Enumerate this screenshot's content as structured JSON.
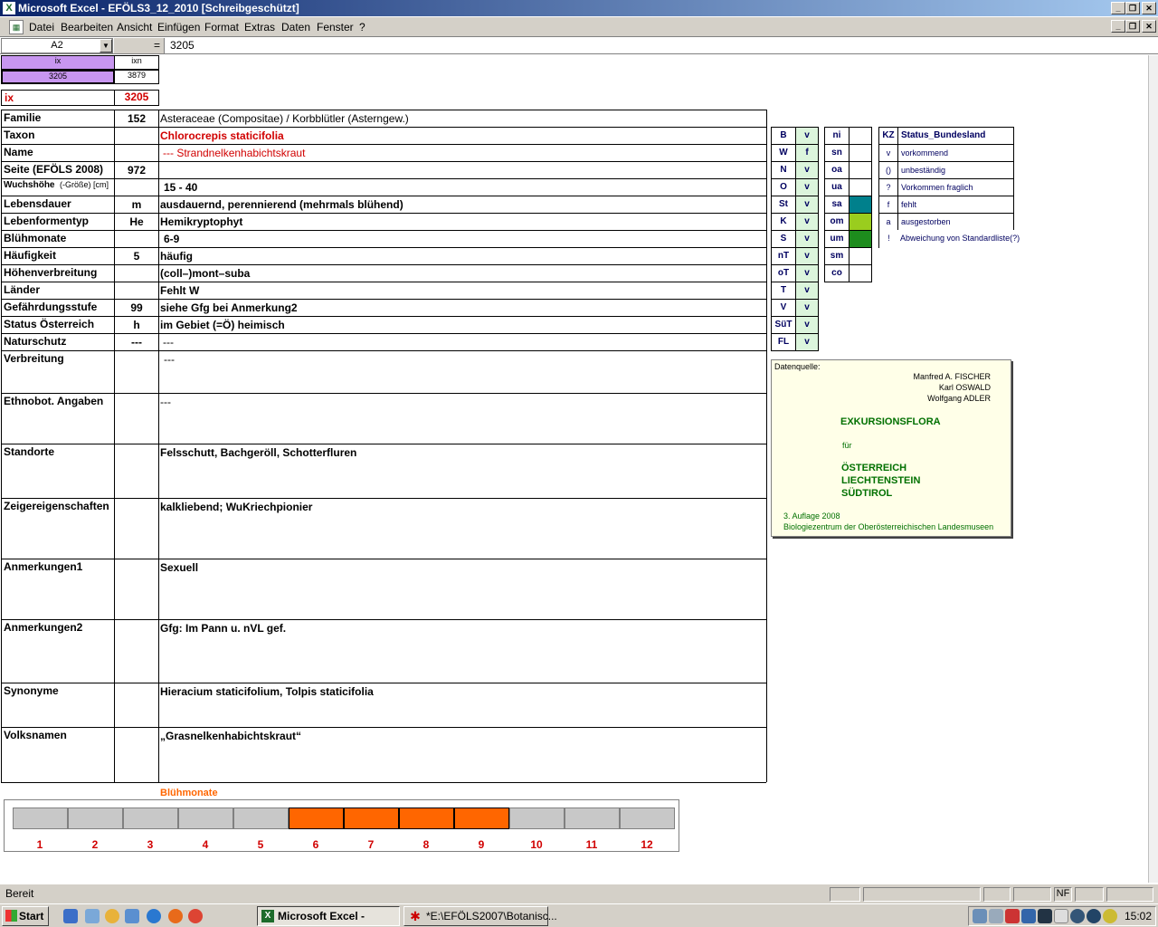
{
  "window": {
    "title": "Microsoft Excel - EFÖLS3_12_2010  [Schreibgeschützt]",
    "app_icon": "excel-icon"
  },
  "menu": [
    "Datei",
    "Bearbeiten",
    "Ansicht",
    "Einfügen",
    "Format",
    "Extras",
    "Daten",
    "Fenster",
    "?"
  ],
  "formula": {
    "name_box": "A2",
    "equals": "=",
    "value": "3205"
  },
  "top_cells": {
    "ix_header": "ix",
    "ixn_header": "ixn",
    "ix_value": "3205",
    "ixn_value": "3879",
    "ix_label": "ix",
    "ix_display": "3205"
  },
  "rows": [
    {
      "label": "Familie",
      "code": "152",
      "value": "Asteraceae (Compositae)  /  Korbblütler (Asterngew.)"
    },
    {
      "label": "Taxon",
      "code": "",
      "value": "Chlorocrepis staticifolia"
    },
    {
      "label": "Name",
      "code": "",
      "value": "--- Strandnelkenhabichtskraut"
    },
    {
      "label": "Seite (EFÖLS 2008)",
      "code": "972",
      "value": ""
    },
    {
      "label": "Wuchshöhe",
      "label_suffix": "(-Größe) [cm]",
      "code": "",
      "value": "15 - 40"
    },
    {
      "label": "Lebensdauer",
      "code": "m",
      "value": "ausdauernd, perennierend (mehrmals blühend)"
    },
    {
      "label": "Lebenformentyp",
      "code": "He",
      "value": "Hemikryptophyt"
    },
    {
      "label": "Blühmonate",
      "code": "",
      "value": "6-9"
    },
    {
      "label": "Häufigkeit",
      "code": "5",
      "value": "häufig"
    },
    {
      "label": "Höhenverbreitung",
      "code": "",
      "value": "(coll–)mont–suba"
    },
    {
      "label": "Länder",
      "code": "",
      "value": "Fehlt W"
    },
    {
      "label": "Gefährdungsstufe",
      "code": "99",
      "value": "siehe Gfg bei Anmerkung2"
    },
    {
      "label": "Status Österreich",
      "code": "h",
      "value": "im Gebiet (=Ö) heimisch"
    },
    {
      "label": "Naturschutz",
      "code": "---",
      "value": "---"
    }
  ],
  "big_rows": [
    {
      "label": "Verbreitung",
      "value": "---"
    },
    {
      "label": "Ethnobot. Angaben",
      "value": "---"
    },
    {
      "label": "Standorte",
      "value": "Felsschutt, Bachgeröll, Schotterfluren"
    },
    {
      "label": "Zeigereigenschaften",
      "value": "kalkliebend; WuKriechpionier"
    },
    {
      "label": "Anmerkungen1",
      "value": "Sexuell"
    },
    {
      "label": "Anmerkungen2",
      "value": "Gfg: Im Pann u. nVL gef."
    },
    {
      "label": "Synonyme",
      "value": "Hieracium staticifolium, Tolpis staticifolia"
    },
    {
      "label": "Volksnamen",
      "value": "„Grasnelkenhabichtskraut“"
    }
  ],
  "regions": [
    {
      "code": "B",
      "status": "v"
    },
    {
      "code": "W",
      "status": "f"
    },
    {
      "code": "N",
      "status": "v"
    },
    {
      "code": "O",
      "status": "v"
    },
    {
      "code": "St",
      "status": "v"
    },
    {
      "code": "K",
      "status": "v"
    },
    {
      "code": "S",
      "status": "v"
    },
    {
      "code": "nT",
      "status": "v"
    },
    {
      "code": "oT",
      "status": "v"
    },
    {
      "code": "T",
      "status": "v"
    },
    {
      "code": "V",
      "status": "v"
    },
    {
      "code": "SüT",
      "status": "v"
    },
    {
      "code": "FL",
      "status": "v"
    }
  ],
  "zones": [
    {
      "code": "ni",
      "color": ""
    },
    {
      "code": "sn",
      "color": ""
    },
    {
      "code": "oa",
      "color": ""
    },
    {
      "code": "ua",
      "color": ""
    },
    {
      "code": "sa",
      "color": "#00808c"
    },
    {
      "code": "om",
      "color": "#9acd1e"
    },
    {
      "code": "um",
      "color": "#1d8c1d"
    },
    {
      "code": "sm",
      "color": ""
    },
    {
      "code": "co",
      "color": ""
    }
  ],
  "status_legend": {
    "header_kz": "KZ",
    "header_title": "Status_Bundesland",
    "items": [
      {
        "kz": "v",
        "text": "vorkommend"
      },
      {
        "kz": "()",
        "text": "unbeständig"
      },
      {
        "kz": "?",
        "text": "Vorkommen fraglich"
      },
      {
        "kz": "f",
        "text": "fehlt"
      },
      {
        "kz": "a",
        "text": "ausgestorben"
      },
      {
        "kz": "!",
        "text": "Abweichung von Standardliste(?)"
      }
    ]
  },
  "source": {
    "label": "Datenquelle:",
    "authors": [
      "Manfred A. FISCHER",
      "Karl OSWALD",
      "Wolfgang ADLER"
    ],
    "book": "EXKURSIONSFLORA",
    "for": "für",
    "countries": [
      "ÖSTERREICH",
      "LIECHTENSTEIN",
      "SÜDTIROL"
    ],
    "edition": "3. Auflage 2008",
    "publisher": "Biologiezentrum der Oberösterreichischen Landesmuseen"
  },
  "bluehmonate": {
    "title": "Blühmonate",
    "months": [
      "1",
      "2",
      "3",
      "4",
      "5",
      "6",
      "7",
      "8",
      "9",
      "10",
      "11",
      "12"
    ],
    "active": [
      6,
      7,
      8,
      9
    ],
    "active_color": "#ff6600",
    "inactive_color": "#c8c8c8"
  },
  "statusbar": {
    "text": "Bereit",
    "nf": "NF"
  },
  "taskbar": {
    "start": "Start",
    "task1": "Microsoft Excel - EFÖL...",
    "task2": "*E:\\EFÖLS2007\\Botanisc...",
    "clock": "15:02"
  }
}
